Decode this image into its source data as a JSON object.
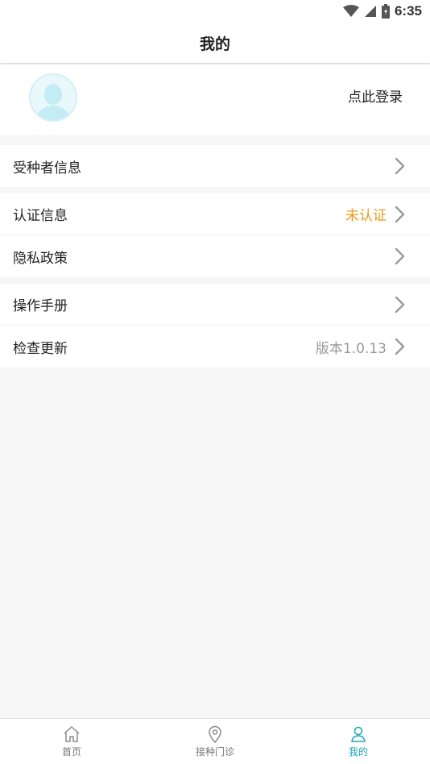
{
  "status": {
    "time": "6:35"
  },
  "header": {
    "title": "我的"
  },
  "profile": {
    "login_label": "点此登录"
  },
  "menu": {
    "recipient": {
      "label": "受种者信息"
    },
    "certification": {
      "label": "认证信息",
      "value": "未认证"
    },
    "privacy": {
      "label": "隐私政策"
    },
    "manual": {
      "label": "操作手册"
    },
    "update": {
      "label": "检查更新",
      "value": "版本1.0.13"
    }
  },
  "tabs": [
    {
      "label": "首页",
      "icon": "home-icon"
    },
    {
      "label": "接种门诊",
      "icon": "location-pin-icon"
    },
    {
      "label": "我的",
      "icon": "user-icon",
      "active": true
    }
  ],
  "colors": {
    "accent": "#1aa6b8",
    "warning": "#eb9a1d",
    "muted": "#999999"
  }
}
